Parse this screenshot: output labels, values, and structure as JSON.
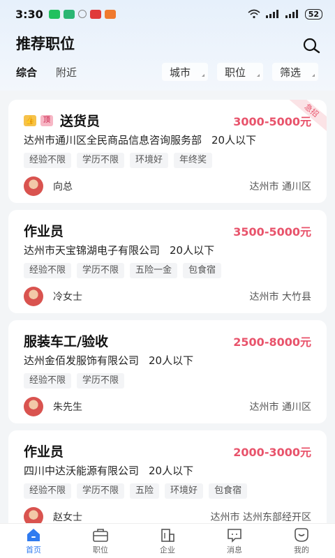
{
  "status_bar": {
    "time": "3:30",
    "battery": "52"
  },
  "header": {
    "title": "推荐职位"
  },
  "filters": {
    "tabs": [
      {
        "label": "综合"
      },
      {
        "label": "附近"
      }
    ],
    "dropdowns": [
      {
        "label": "城市"
      },
      {
        "label": "职位"
      },
      {
        "label": "筛选"
      }
    ]
  },
  "jobs": [
    {
      "title": "送货员",
      "salary": "3000-5000元",
      "company": "达州市通川区全民商品信息咨询服务部",
      "size": "20人以下",
      "tags": [
        "经验不限",
        "学历不限",
        "环境好",
        "年终奖"
      ],
      "recruiter": "向总",
      "location": "达州市 通川区",
      "ribbon": "急招",
      "top_badge": "顶"
    },
    {
      "title": "作业员",
      "salary": "3500-5000元",
      "company": "达州市天宝锦湖电子有限公司",
      "size": "20人以下",
      "tags": [
        "经验不限",
        "学历不限",
        "五险一金",
        "包食宿"
      ],
      "recruiter": "冷女士",
      "location": "达州市 大竹县"
    },
    {
      "title": "服装车工/验收",
      "salary": "2500-8000元",
      "company": "达州金佰发服饰有限公司",
      "size": "20人以下",
      "tags": [
        "经验不限",
        "学历不限"
      ],
      "recruiter": "朱先生",
      "location": "达州市 通川区"
    },
    {
      "title": "作业员",
      "salary": "2000-3000元",
      "company": "四川中达沃能源有限公司",
      "size": "20人以下",
      "tags": [
        "经验不限",
        "学历不限",
        "五险",
        "环境好",
        "包食宿"
      ],
      "recruiter": "赵女士",
      "location": "达州市 达州东部经开区"
    }
  ],
  "bottom_nav": [
    {
      "label": "首页",
      "icon": "home-icon",
      "active": true
    },
    {
      "label": "职位",
      "icon": "briefcase-icon"
    },
    {
      "label": "企业",
      "icon": "building-icon"
    },
    {
      "label": "消息",
      "icon": "message-icon"
    },
    {
      "label": "我的",
      "icon": "profile-icon"
    }
  ],
  "colors": {
    "accent": "#2f7bf0",
    "salary": "#e8536b"
  }
}
